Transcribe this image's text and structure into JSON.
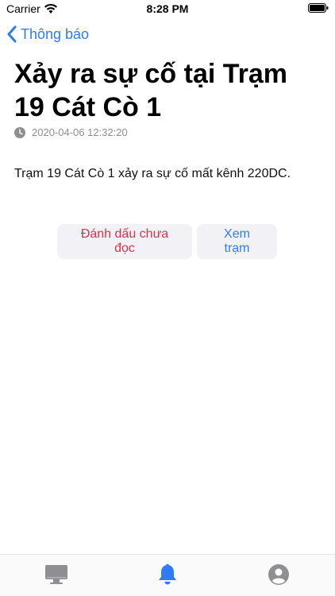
{
  "status_bar": {
    "carrier": "Carrier",
    "time": "8:28 PM"
  },
  "nav": {
    "back_label": "Thông báo"
  },
  "notification": {
    "title": "Xảy ra sự cố tại Trạm 19 Cát Cò 1",
    "timestamp": "2020-04-06 12:32:20",
    "message": "Trạm 19 Cát Cò 1 xảy ra sự cố mất kênh 220DC."
  },
  "actions": {
    "mark_unread_label": "Đánh dấu chưa đọc",
    "view_station_label": "Xem trạm"
  },
  "tab_bar": {
    "tabs": [
      {
        "icon": "monitor-icon",
        "active": false
      },
      {
        "icon": "bell-icon",
        "active": true
      },
      {
        "icon": "profile-icon",
        "active": false
      }
    ]
  },
  "colors": {
    "accent_blue": "#2f7bf5",
    "danger_red": "#d9324c",
    "muted_gray": "#8e8e93",
    "button_bg": "#f2f2f6"
  }
}
